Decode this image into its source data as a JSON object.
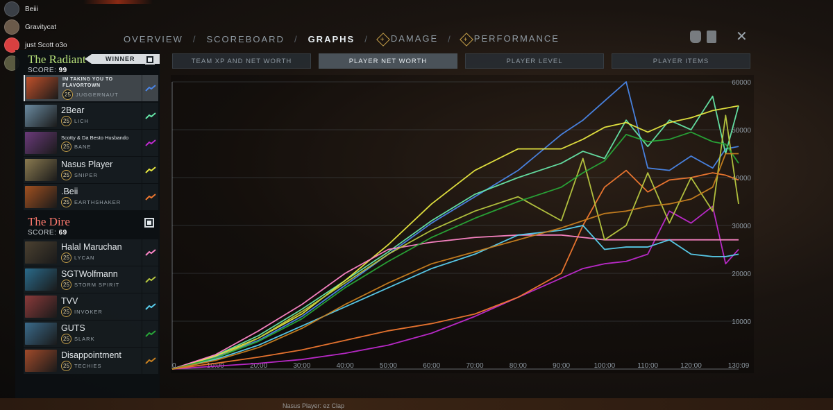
{
  "discord": [
    {
      "name": "Beiii",
      "color": "#3a3f46"
    },
    {
      "name": "Gravitycat",
      "color": "#6b5a4a"
    },
    {
      "name": "just Scott o3o",
      "color": "#d94040"
    },
    {
      "name": "",
      "color": "#5a5a40"
    }
  ],
  "nav": {
    "overview": "OVERVIEW",
    "scoreboard": "SCOREBOARD",
    "graphs": "GRAPHS",
    "damage": "DAMAGE",
    "performance": "PERFORMANCE",
    "close": "✕"
  },
  "radiant": {
    "name": "The Radiant",
    "score_label": "SCORE:",
    "score": "99",
    "winner": "WINNER"
  },
  "dire": {
    "name": "The Dire",
    "score_label": "SCORE:",
    "score": "69"
  },
  "players": [
    {
      "name": "IM TAKING YOU TO FLAVORTOWN",
      "level": "25",
      "hero": "JUGGERNAUT",
      "color": "#4a86e8",
      "portrait": "#c0502a",
      "style": "smallcaps",
      "selected": true
    },
    {
      "name": "2Bear",
      "level": "25",
      "hero": "LICH",
      "color": "#66e6a8",
      "portrait": "#6a8aa0",
      "style": "normal"
    },
    {
      "name": "Scotty & Da Besto Husbando",
      "level": "25",
      "hero": "BANE",
      "color": "#c02ad0",
      "portrait": "#6a3a7a",
      "style": "small"
    },
    {
      "name": "Nasus Player",
      "level": "25",
      "hero": "SNIPER",
      "color": "#e8e840",
      "portrait": "#8a7a50",
      "style": "normal"
    },
    {
      "name": ".Beii",
      "level": "25",
      "hero": "EARTHSHAKER",
      "color": "#f07830",
      "portrait": "#a05020",
      "style": "normal"
    },
    {
      "name": "Halal Maruchan",
      "level": "25",
      "hero": "LYCAN",
      "color": "#ff86c8",
      "portrait": "#4a4030",
      "style": "normal"
    },
    {
      "name": "SGTWolfmann",
      "level": "25",
      "hero": "STORM SPIRIT",
      "color": "#b8c840",
      "portrait": "#2a6a8a",
      "style": "normal"
    },
    {
      "name": "TVV",
      "level": "25",
      "hero": "INVOKER",
      "color": "#5ad0f0",
      "portrait": "#8a3a3a",
      "style": "normal"
    },
    {
      "name": "GUTS",
      "level": "25",
      "hero": "SLARK",
      "color": "#28a838",
      "portrait": "#3a6a8a",
      "style": "normal"
    },
    {
      "name": "Disappointment",
      "level": "25",
      "hero": "TECHIES",
      "color": "#c88020",
      "portrait": "#a04a2a",
      "style": "normal"
    }
  ],
  "subtabs": [
    "TEAM XP AND NET WORTH",
    "PLAYER NET WORTH",
    "PLAYER LEVEL",
    "PLAYER ITEMS"
  ],
  "active_subtab": 1,
  "chat": "Nasus Player: ez Clap",
  "chart_data": {
    "type": "line",
    "x_ticks": [
      "0",
      "10:00",
      "20:00",
      "30:00",
      "40:00",
      "50:00",
      "60:00",
      "70:00",
      "80:00",
      "90:00",
      "100:00",
      "110:00",
      "120:00",
      "130:09"
    ],
    "y_ticks": [
      10000,
      20000,
      30000,
      40000,
      50000,
      60000
    ],
    "ylim": [
      0,
      60000
    ],
    "xlim": [
      0,
      131
    ],
    "x": [
      0,
      10,
      20,
      30,
      40,
      50,
      60,
      70,
      80,
      90,
      95,
      100,
      105,
      110,
      115,
      120,
      125,
      128,
      131
    ],
    "series": [
      {
        "player": 0,
        "values": [
          0,
          2500,
          6000,
          11000,
          17500,
          24000,
          30500,
          36000,
          41500,
          49000,
          52000,
          56000,
          60000,
          42000,
          41500,
          44500,
          42000,
          46000,
          46500
        ]
      },
      {
        "player": 1,
        "values": [
          0,
          2800,
          7000,
          12500,
          18500,
          24500,
          31000,
          36500,
          40000,
          43000,
          45500,
          44000,
          52000,
          46500,
          52000,
          50000,
          57000,
          45000,
          55000
        ]
      },
      {
        "player": 2,
        "values": [
          0,
          600,
          1200,
          2000,
          3300,
          5000,
          7500,
          11000,
          15000,
          19000,
          21000,
          22000,
          22500,
          24000,
          33000,
          30500,
          34000,
          22000,
          25000
        ]
      },
      {
        "player": 3,
        "values": [
          0,
          2700,
          6500,
          11500,
          18500,
          26000,
          34500,
          41500,
          46000,
          46000,
          48000,
          50500,
          51500,
          49500,
          51500,
          52500,
          54000,
          54500,
          55000
        ]
      },
      {
        "player": 4,
        "values": [
          0,
          1200,
          2500,
          4000,
          6000,
          8000,
          9500,
          11500,
          15000,
          20000,
          30000,
          38000,
          41500,
          37000,
          39500,
          40000,
          41000,
          40500,
          39500
        ]
      },
      {
        "player": 5,
        "values": [
          0,
          3000,
          8000,
          13500,
          20000,
          25000,
          26500,
          27500,
          28000,
          28000,
          27500,
          27000,
          27000,
          27000,
          27000,
          27000,
          27000,
          27000,
          27000
        ]
      },
      {
        "player": 6,
        "values": [
          0,
          2200,
          6500,
          12000,
          18000,
          24000,
          29000,
          33000,
          36000,
          31000,
          44000,
          27000,
          30000,
          41000,
          30500,
          40000,
          33000,
          53000,
          34500
        ]
      },
      {
        "player": 7,
        "values": [
          0,
          2000,
          5000,
          9000,
          13000,
          17000,
          21000,
          24000,
          28000,
          29000,
          30000,
          25000,
          25500,
          25500,
          27000,
          24000,
          23500,
          23500,
          24000
        ]
      },
      {
        "player": 8,
        "values": [
          0,
          2300,
          5800,
          10500,
          17000,
          22500,
          27500,
          31500,
          35000,
          38000,
          41000,
          43500,
          49000,
          47500,
          48000,
          49500,
          47500,
          47000,
          43000
        ]
      },
      {
        "player": 9,
        "values": [
          0,
          1800,
          4500,
          8500,
          13500,
          18000,
          22000,
          24500,
          27000,
          29500,
          31000,
          32500,
          33000,
          34000,
          34500,
          35500,
          38000,
          45000,
          45000
        ]
      }
    ]
  }
}
